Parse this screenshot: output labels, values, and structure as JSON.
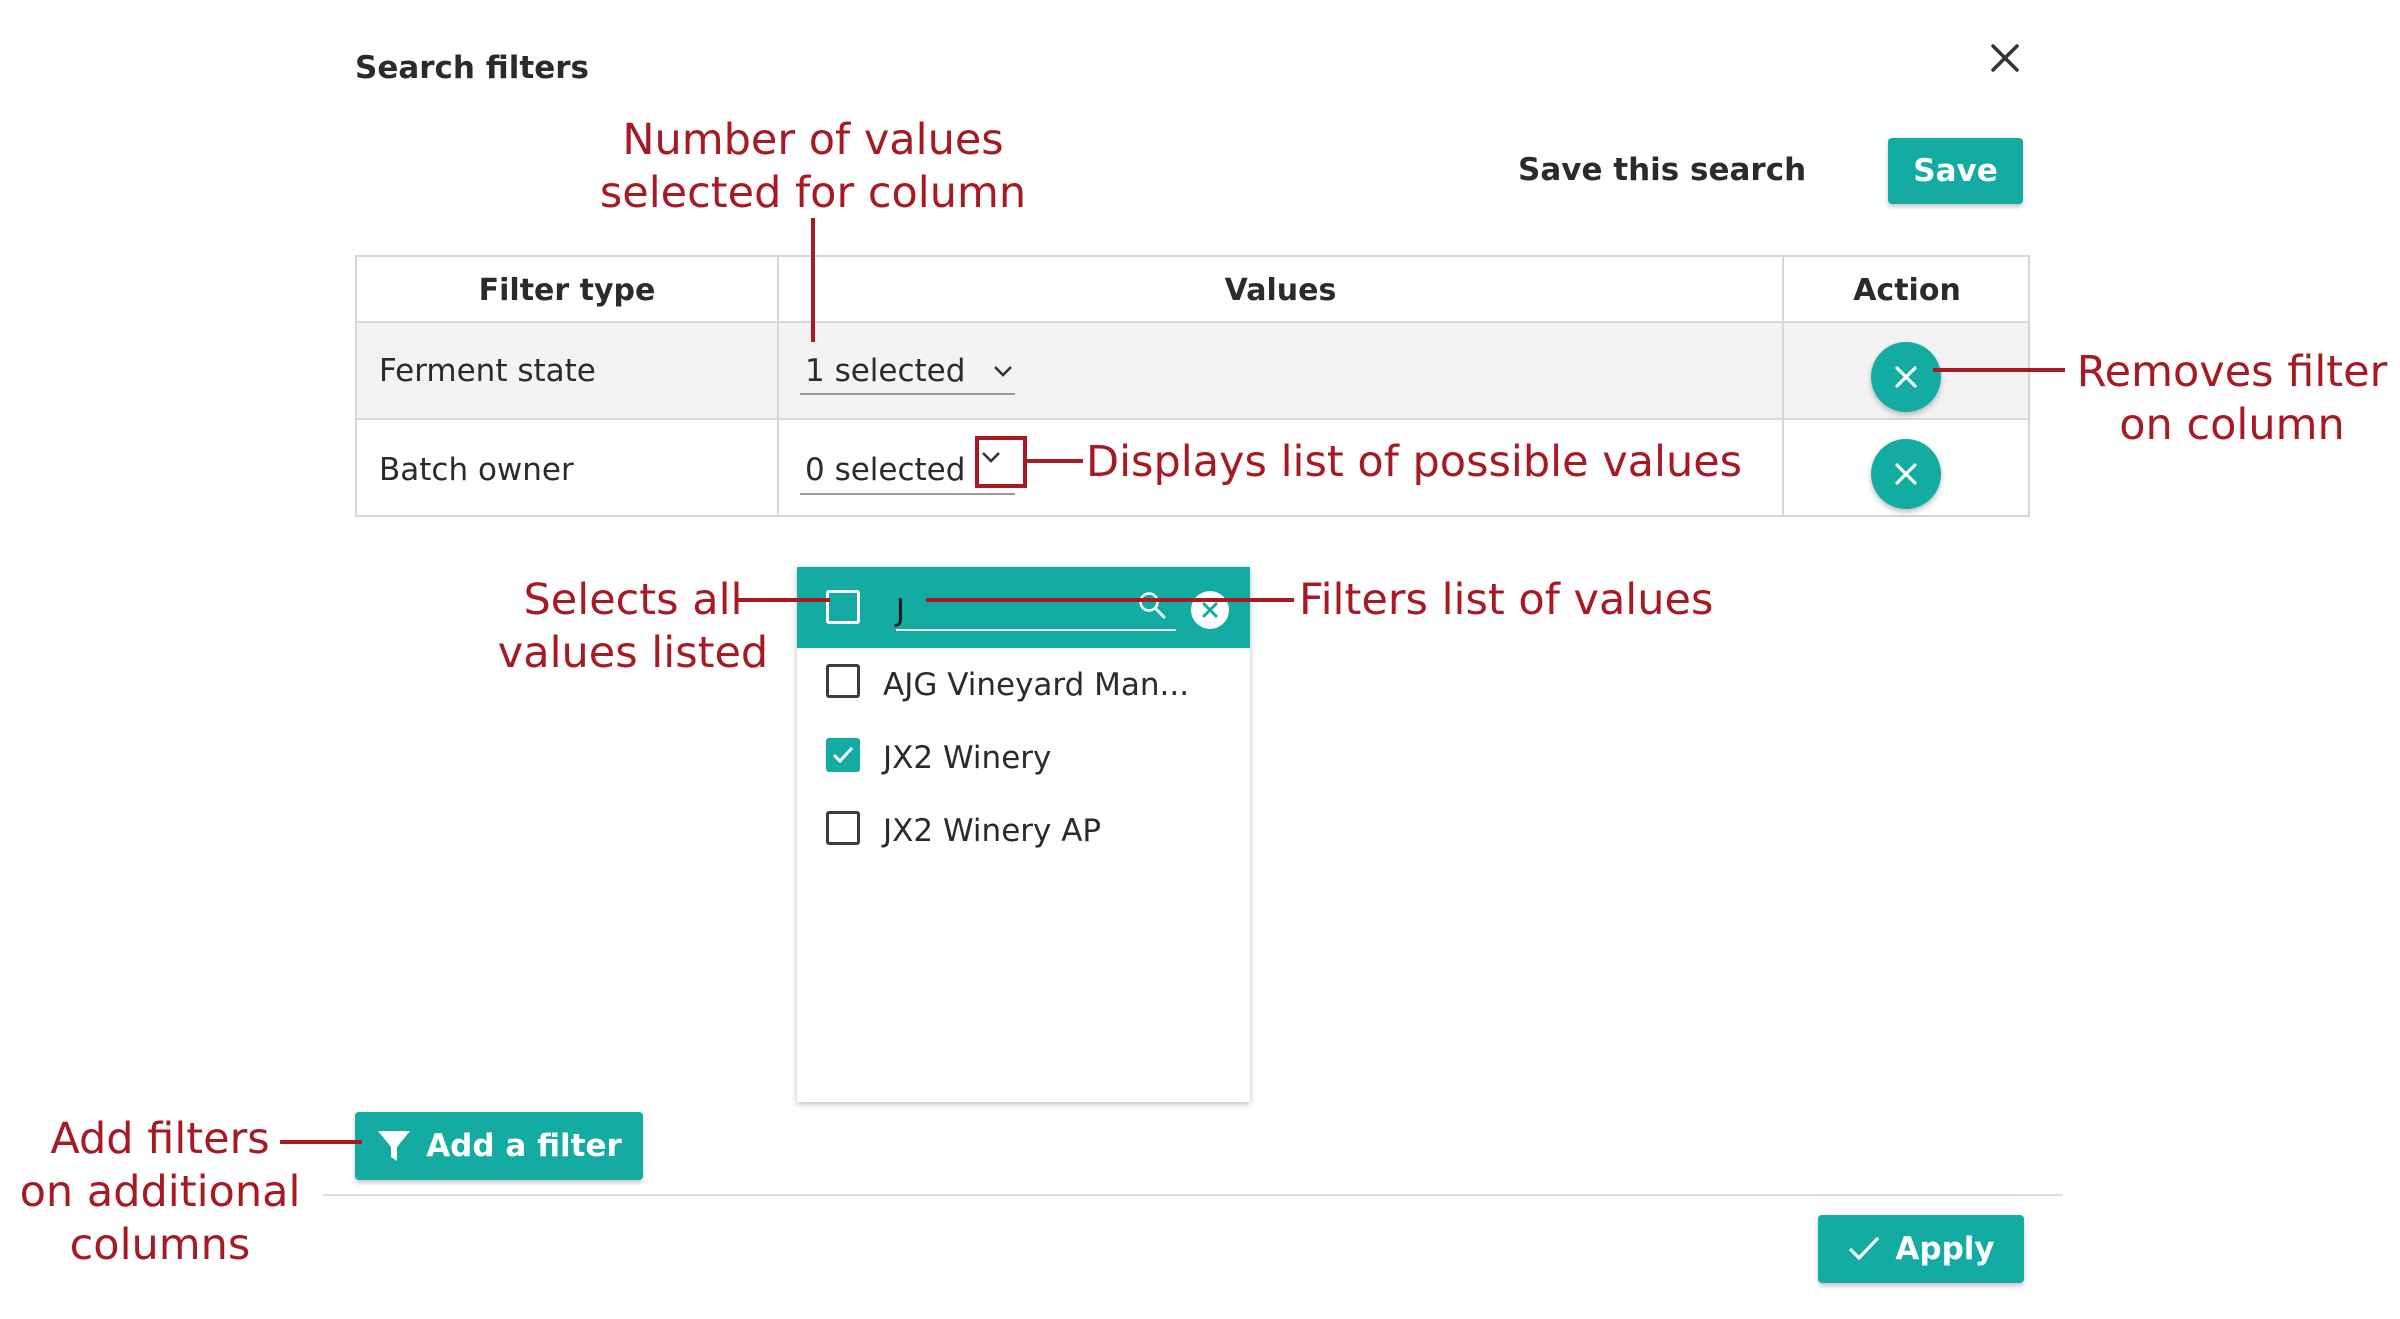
{
  "dialog": {
    "title": "Search filters"
  },
  "save_search": {
    "label": "Save this search",
    "button": "Save"
  },
  "table": {
    "headers": [
      "Filter type",
      "Values",
      "Action"
    ],
    "rows": [
      {
        "filter_type": "Ferment state",
        "values": "1 selected"
      },
      {
        "filter_type": "Batch owner",
        "values": "0 selected"
      }
    ]
  },
  "dropdown": {
    "search_value": "J",
    "items": [
      {
        "label": "AJG Vineyard Man...",
        "checked": false
      },
      {
        "label": "JX2 Winery",
        "checked": true
      },
      {
        "label": "JX2 Winery AP",
        "checked": false
      }
    ]
  },
  "footer": {
    "add_filter": "Add a filter",
    "apply": "Apply"
  },
  "annotations": {
    "number_of_values": [
      "Number of values",
      "selected for column"
    ],
    "removes_filter": [
      "Removes filter",
      "on column"
    ],
    "displays_list": "Displays list of possible values",
    "selects_all": [
      "Selects all",
      "values listed"
    ],
    "filters_list": "Filters list of values",
    "add_filters": [
      "Add filters",
      "on additional",
      "columns"
    ]
  },
  "colors": {
    "accent": "#13aba2",
    "annotation": "#a71a24"
  },
  "icons": [
    "close-icon",
    "clear-icon",
    "chevron-down-icon",
    "search-icon",
    "filter-funnel-icon",
    "checkmark-icon"
  ]
}
